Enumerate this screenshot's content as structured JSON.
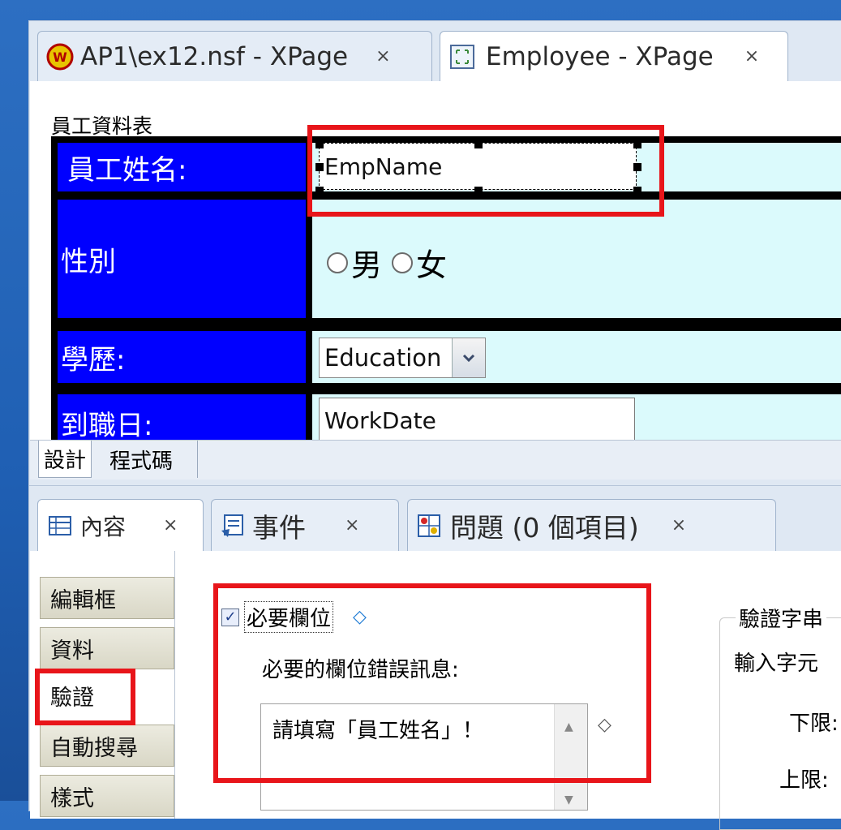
{
  "editor": {
    "tabs": [
      {
        "label": "AP1\\ex12.nsf - XPage",
        "close": "×",
        "icon": "notes-db-icon"
      },
      {
        "label": "Employee - XPage",
        "close": "×",
        "icon": "xpage-icon"
      }
    ],
    "form": {
      "caption": "員工資料表",
      "rows": {
        "name_label": "員工姓名:",
        "name_field": "EmpName",
        "gender_label": "性別",
        "gender_options": [
          "男",
          "女"
        ],
        "education_label": "學歷:",
        "education_value": "Education",
        "workdate_label": "到職日:",
        "workdate_field": "WorkDate"
      }
    },
    "view_tabs": [
      "設計",
      "程式碼"
    ]
  },
  "properties": {
    "tabs": [
      {
        "label": "內容",
        "close": "×",
        "icon": "properties-icon"
      },
      {
        "label": "事件",
        "close": "×",
        "icon": "events-icon"
      },
      {
        "label": "問題 (0 個項目)",
        "close": "×",
        "icon": "problems-icon"
      }
    ],
    "side_tabs": [
      "編輯框",
      "資料",
      "驗證",
      "自動搜尋",
      "樣式"
    ],
    "validation": {
      "required_label": "必要欄位",
      "required_checked": true,
      "error_msg_label": "必要的欄位錯誤訊息:",
      "error_msg_value": "請填寫「員工姓名」！",
      "group_title": "驗證字串",
      "input_chars_label": "輸入字元",
      "min_label": "下限:",
      "max_label": "上限:"
    }
  },
  "colors": {
    "highlight": "#e8151a",
    "label_bg": "#0000ff",
    "cell_bg": "#dbfafc"
  }
}
